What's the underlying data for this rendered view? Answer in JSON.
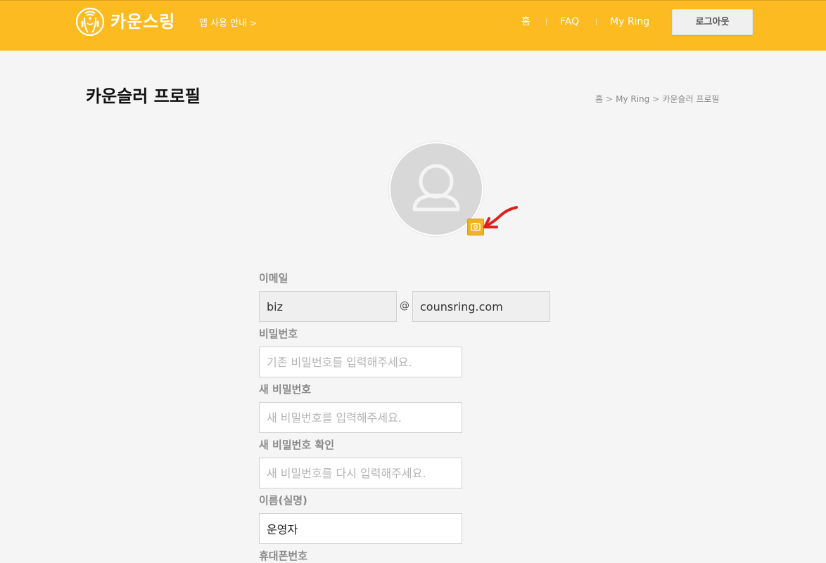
{
  "header": {
    "brand": "카운스링",
    "guide_link": "앱 사용 안내",
    "guide_chevron": ">",
    "nav": [
      {
        "label": "홈"
      },
      {
        "label": "FAQ"
      },
      {
        "label": "My Ring"
      }
    ],
    "logout": "로그아웃"
  },
  "page": {
    "title": "카운슬러 프로필",
    "breadcrumb": [
      "홈",
      "My Ring",
      "카운슬러 프로필"
    ],
    "breadcrumb_sep": ">"
  },
  "form": {
    "email_label": "이메일",
    "email_local": "biz",
    "email_at": "@",
    "email_domain": "counsring.com",
    "password_label": "비밀번호",
    "password_placeholder": "기존 비밀번호를 입력해주세요.",
    "new_password_label": "새 비밀번호",
    "new_password_placeholder": "새 비밀번호를 입력해주세요.",
    "confirm_password_label": "새 비밀번호 확인",
    "confirm_password_placeholder": "새 비밀번호를 다시 입력해주세요.",
    "name_label": "이름(실명)",
    "name_value": "운영자",
    "phone_label": "휴대폰번호"
  },
  "colors": {
    "header_bg": "#fbbb21",
    "camera_button": "#f2b21f",
    "annotation_arrow": "#e0201b"
  },
  "icons": {
    "logo": "headphones-person-icon",
    "avatar": "default-user-icon",
    "camera": "camera-icon",
    "annotation": "red-arrow-icon"
  }
}
